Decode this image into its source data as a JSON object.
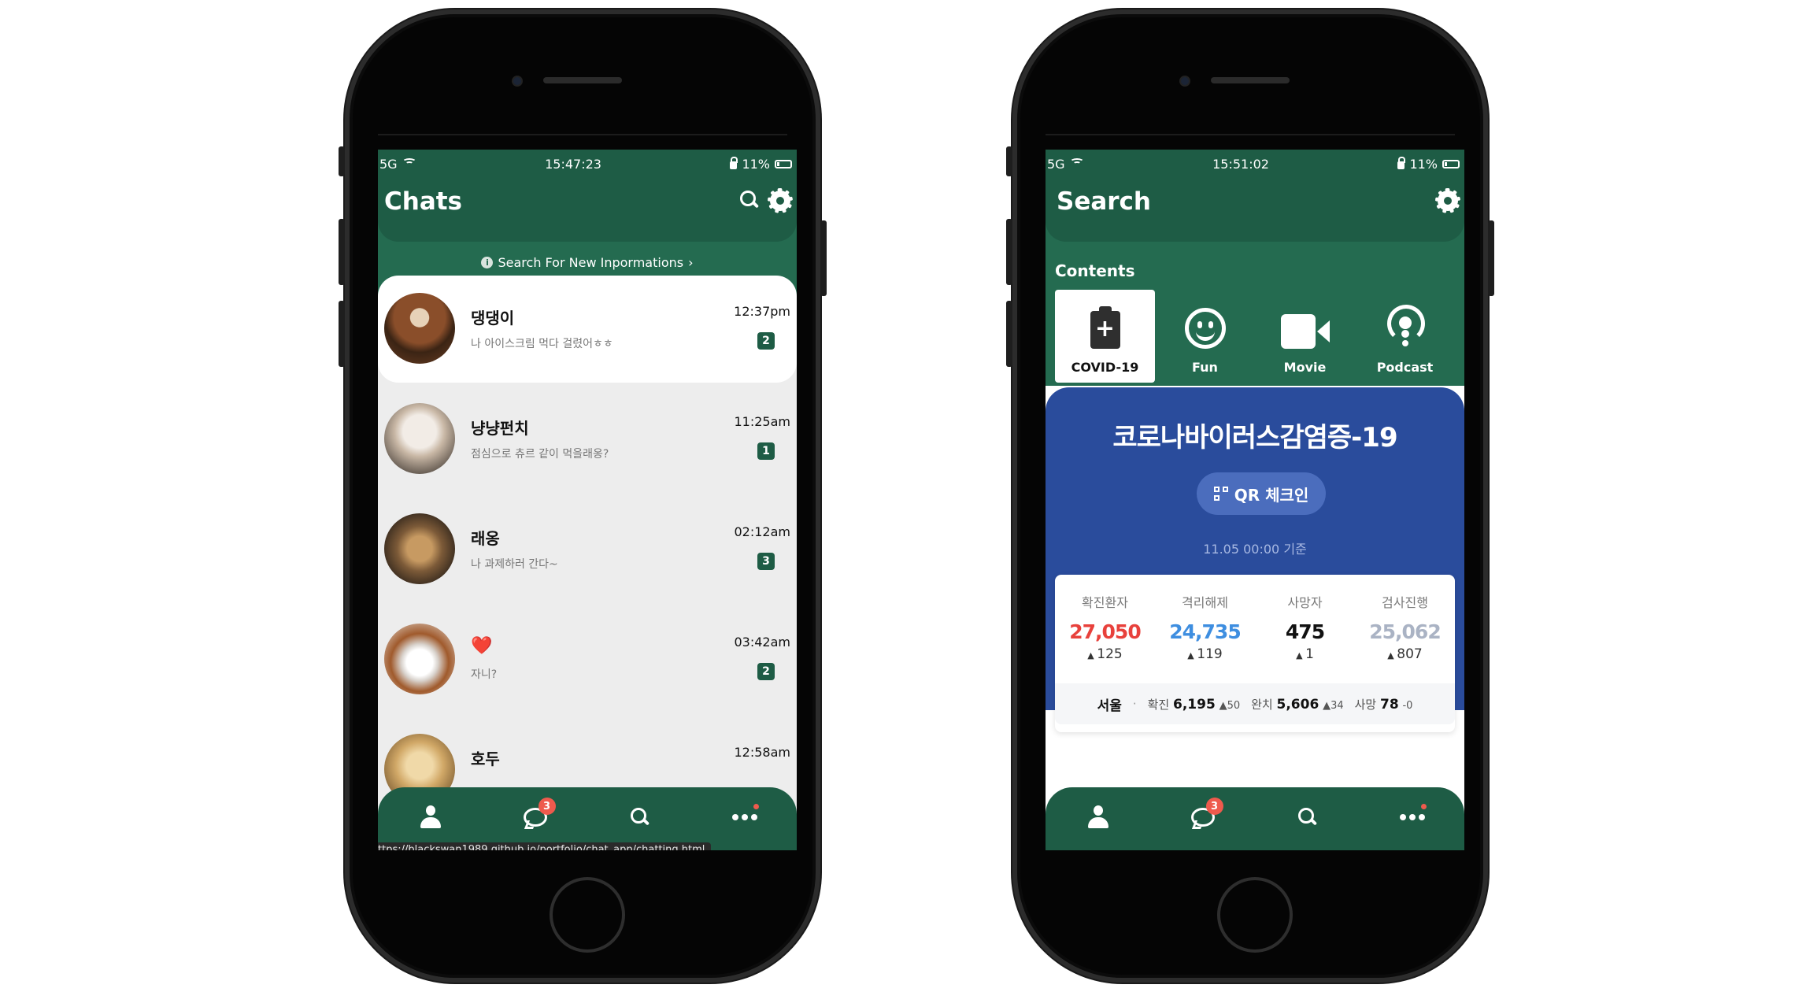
{
  "left_phone": {
    "status": {
      "network": "5G",
      "time": "15:47:23",
      "battery": "11%"
    },
    "header": {
      "title": "Chats"
    },
    "banner": {
      "text": "Search For New Inpormations"
    },
    "chats": [
      {
        "name": "댕댕이",
        "message": "나 아이스크림 먹다 걸렸어ㅎㅎ",
        "time": "12:37pm",
        "unread": "2"
      },
      {
        "name": "냥냥펀치",
        "message": "점심으로 츄르 같이 먹을래옹?",
        "time": "11:25am",
        "unread": "1"
      },
      {
        "name": "래옹",
        "message": "나 과제하러 간다~",
        "time": "02:12am",
        "unread": "3"
      },
      {
        "name": "❤️",
        "message": "자니?",
        "time": "03:42am",
        "unread": "2"
      },
      {
        "name": "호두",
        "message": "",
        "time": "12:58am",
        "unread": ""
      }
    ],
    "tabbar": {
      "chat_badge": "3"
    },
    "url_tooltip": "ttps://blackswan1989.github.io/portfolio/chat_app/chatting.html"
  },
  "right_phone": {
    "status": {
      "network": "5G",
      "time": "15:51:02",
      "battery": "11%"
    },
    "header": {
      "title": "Search"
    },
    "contents": {
      "label": "Contents",
      "items": [
        {
          "label": "COVID-19",
          "icon": "clipboard-plus-icon"
        },
        {
          "label": "Fun",
          "icon": "smile-icon"
        },
        {
          "label": "Movie",
          "icon": "video-camera-icon"
        },
        {
          "label": "Podcast",
          "icon": "podcast-icon"
        }
      ]
    },
    "covid": {
      "title": "코로나바이러스감염증-19",
      "qr_button": "QR 체크인",
      "date": "11.05 00:00 기준",
      "stats": [
        {
          "label": "확진환자",
          "value": "27,050",
          "delta": "125",
          "color": "#e8413c"
        },
        {
          "label": "격리해제",
          "value": "24,735",
          "delta": "119",
          "color": "#3e8ee0"
        },
        {
          "label": "사망자",
          "value": "475",
          "delta": "1",
          "color": "#111111"
        },
        {
          "label": "검사진행",
          "value": "25,062",
          "delta": "807",
          "color": "#aab3c4"
        }
      ],
      "seoul": {
        "region": "서울",
        "confirmed_label": "확진",
        "confirmed": "6,195",
        "confirmed_delta": "▲50",
        "recovered_label": "완치",
        "recovered": "5,606",
        "recovered_delta": "▲34",
        "deaths_label": "사망",
        "deaths": "78",
        "deaths_delta": "-0"
      }
    },
    "tabbar": {
      "chat_badge": "3"
    }
  }
}
